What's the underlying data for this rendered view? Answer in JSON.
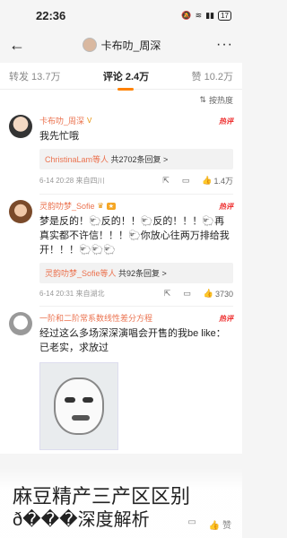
{
  "status": {
    "time": "22:36",
    "battery": "17"
  },
  "nav": {
    "back_icon": "back-arrow-icon",
    "title": "卡布叻_周深",
    "more_icon": "more-dots-icon"
  },
  "tabs": [
    {
      "label": "转发 13.7万"
    },
    {
      "label": "评论 2.4万"
    },
    {
      "label": "赞 10.2万"
    }
  ],
  "sort_label": "按热度",
  "hot_label": "热评",
  "comments": [
    {
      "name": "卡布叻_周深",
      "text": "我先忙哦",
      "reply_who": "ChristinaLam等人",
      "reply_count": " 共2702条回复 >",
      "meta": "6-14 20:28 来自四川",
      "likes": "1.4万"
    },
    {
      "name": "灵韵叻梦_Sofie",
      "text": "梦是反的！🐑反的！！🐑反的！！！🐑再真实都不许信！！！🐑你放心往两万排给我开！！！🐑🐑🐑",
      "reply_who": "灵韵叻梦_Sofie等人",
      "reply_count": " 共92条回复 >",
      "meta": "6-14 20:31 来自湖北",
      "likes": "3730"
    },
    {
      "name": "一阶和二阶常系数线性差分方程",
      "text": "经过这么多场深深演唱会开售的我be like：已老实，求放过"
    }
  ],
  "overlay": {
    "title": "麻豆精产三产区区别",
    "subtitle": "ð���深度解析"
  }
}
